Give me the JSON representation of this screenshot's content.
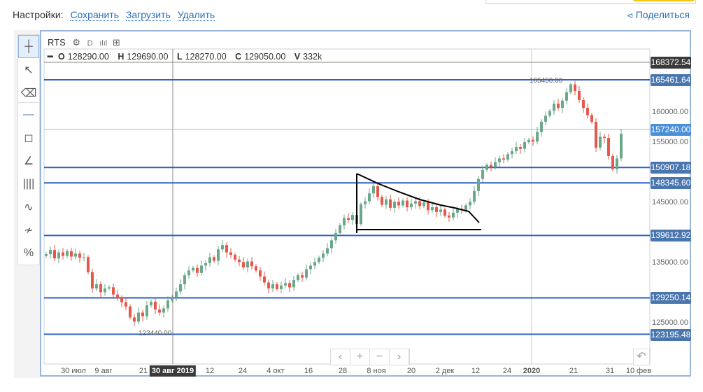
{
  "settings": {
    "label": "Настройки:",
    "save": "Сохранить",
    "load": "Загрузить",
    "delete": "Удалить"
  },
  "share": {
    "label": "Поделиться",
    "icon": "share-icon"
  },
  "toolbar": {
    "tools": [
      "crosshair-icon",
      "pointer-icon",
      "eraser-icon",
      "horizontal-line-icon",
      "rectangle-icon",
      "trend-line-icon",
      "vertical-lines-icon",
      "polyline-icon",
      "channel-icon",
      "percent-icon"
    ]
  },
  "chart": {
    "symbol": "RTS",
    "settings_icon": "gear-icon",
    "period": "D",
    "indicators_icon": "bars-icon",
    "add_icon": "plus-box-icon",
    "ohlc": {
      "o_label": "O",
      "o": "128290.00",
      "h_label": "H",
      "h": "129690.00",
      "l_label": "L",
      "l": "128270.00",
      "c_label": "C",
      "c": "129050.00",
      "v_label": "V",
      "v": "332k"
    },
    "price_labels": [
      {
        "value": "168372.54",
        "price": 168372.54,
        "kind": "crosshair",
        "color": "#3a3a3a"
      },
      {
        "value": "165461.64",
        "price": 165461.64,
        "kind": "level",
        "color": "#4a76b0"
      },
      {
        "value": "157240.00",
        "price": 157240,
        "kind": "last",
        "color": "#4a90d9"
      },
      {
        "value": "150907.18",
        "price": 150907.18,
        "kind": "level",
        "color": "#4a76b0"
      },
      {
        "value": "148345.60",
        "price": 148345.6,
        "kind": "level",
        "color": "#4a76b0"
      },
      {
        "value": "139612.92",
        "price": 139612.92,
        "kind": "level",
        "color": "#4a76b0"
      },
      {
        "value": "129250.14",
        "price": 129250.14,
        "kind": "level",
        "color": "#4a76b0"
      },
      {
        "value": "123195.48",
        "price": 123195.48,
        "kind": "level",
        "color": "#4a76b0"
      }
    ],
    "y_ticks": [
      "160000.00",
      "155000.00",
      "145000.00",
      "135000.00",
      "125000.00"
    ],
    "y_tick_values": [
      160000,
      155000,
      145000,
      135000,
      125000
    ],
    "annotations": {
      "high": "165450.00",
      "low": "123440.00"
    },
    "x_labels": [
      "30 июл",
      "9 авг",
      "21",
      "30 авг 2019",
      "12",
      "24",
      "4 окт",
      "16",
      "28",
      "8 ноя",
      "20",
      "2 дек",
      "12",
      "24",
      "2020",
      "21",
      "31",
      "10 фев"
    ],
    "nav": {
      "left": "‹",
      "zoom_in": "+",
      "zoom_out": "−",
      "right": "›",
      "reset": "↶"
    },
    "colors": {
      "up": "#6aa88a",
      "down": "#e8584a",
      "level": "#2f5fc4"
    }
  },
  "chart_data": {
    "type": "candlestick",
    "closes": [
      136500,
      137200,
      135800,
      136800,
      136200,
      137000,
      136100,
      136600,
      135900,
      136000,
      133500,
      130800,
      131500,
      130200,
      130800,
      131000,
      129800,
      129200,
      128500,
      127800,
      126000,
      125300,
      126800,
      126200,
      128000,
      128600,
      127300,
      126800,
      127500,
      128800,
      129400,
      130300,
      131500,
      133000,
      133800,
      134200,
      133400,
      134600,
      135000,
      136000,
      135400,
      137300,
      138000,
      136800,
      136400,
      135600,
      135200,
      134300,
      135300,
      134500,
      133800,
      132800,
      131800,
      130800,
      131500,
      130700,
      131300,
      131700,
      131000,
      132200,
      133000,
      132600,
      134000,
      134600,
      135200,
      135900,
      136600,
      137500,
      138800,
      140000,
      141300,
      142500,
      142200,
      143000,
      141500,
      144800,
      145300,
      146600,
      147800,
      146000,
      144700,
      145600,
      144200,
      145200,
      144600,
      145400,
      144300,
      144900,
      145300,
      144500,
      145100,
      143800,
      144300,
      143500,
      143900,
      142900,
      142600,
      143400,
      144000,
      143800,
      144600,
      145200,
      147000,
      149000,
      150500,
      151300,
      151000,
      151800,
      152400,
      152200,
      153100,
      153600,
      154300,
      154000,
      155100,
      155500,
      155200,
      156800,
      158500,
      159500,
      160300,
      161500,
      160800,
      162000,
      163400,
      164700,
      163600,
      162100,
      160800,
      159600,
      158500,
      154200,
      156000,
      155800,
      152800,
      150600,
      152400,
      156500
    ]
  }
}
